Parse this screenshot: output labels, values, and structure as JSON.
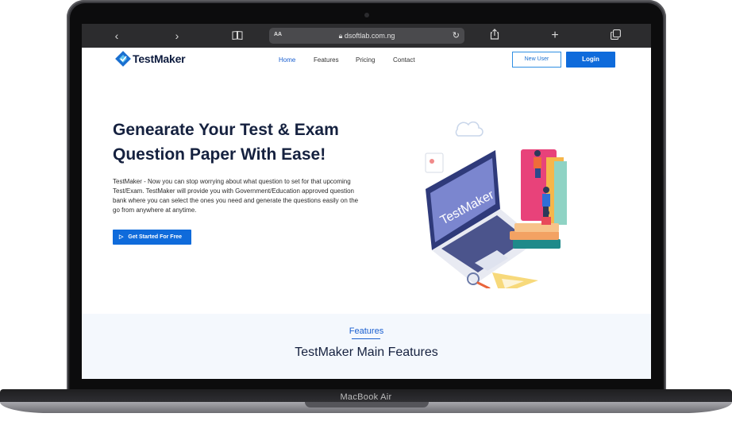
{
  "device": {
    "model_label": "MacBook Air"
  },
  "browser": {
    "url": "dsoftlab.com.ng",
    "aa_label": "AA",
    "icons": [
      "chevron-left-icon",
      "chevron-right-icon",
      "book-icon",
      "lock-icon",
      "reload-icon",
      "share-icon",
      "plus-icon",
      "tabs-icon"
    ]
  },
  "site": {
    "brand": "TestMaker",
    "nav": [
      "Home",
      "Features",
      "Pricing",
      "Contact"
    ],
    "new_user_label": "New User",
    "login_label": "Login",
    "hero": {
      "title": "Genearate Your Test & Exam Question Paper With Ease!",
      "body": "TestMaker - Now you can stop worrying about what question to set for that upcoming Test/Exam. TestMaker will provide you with Government/Education approved question bank where you can select the ones you need and generate the questions easily on the go from anywhere at anytime.",
      "cta_label": "Get Started For Free",
      "illustration_text": "TestMaker"
    },
    "features": {
      "label": "Features",
      "title": "TestMaker Main Features"
    },
    "colors": {
      "primary": "#0f6bdb",
      "heading": "#15213f",
      "section_bg": "#f4f8fd"
    }
  }
}
